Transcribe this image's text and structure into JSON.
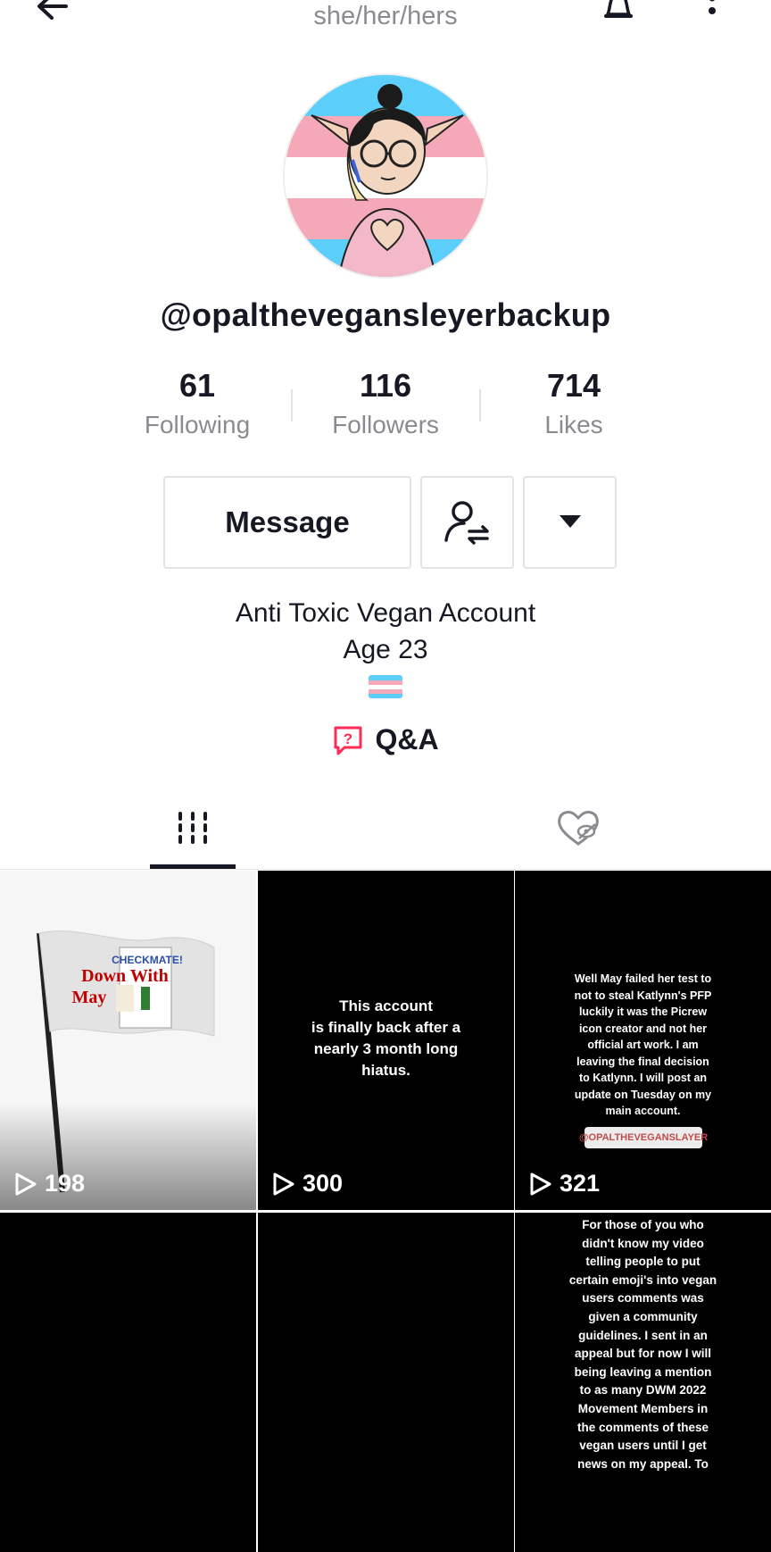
{
  "header": {
    "pronouns": "she/her/hers"
  },
  "profile": {
    "handle": "@opalthevegansleyerbackup",
    "stats": [
      {
        "value": "61",
        "label": "Following"
      },
      {
        "value": "116",
        "label": "Followers"
      },
      {
        "value": "714",
        "label": "Likes"
      }
    ],
    "message_label": "Message",
    "bio_line1": "Anti Toxic Vegan Account",
    "bio_line2": "Age 23",
    "qa_label": "Q&A"
  },
  "colors": {
    "trans_blue": "#5bcefa",
    "trans_pink": "#f5a9b8",
    "accent_red": "#fe2c55",
    "text": "#161823",
    "muted": "#8a8b91"
  },
  "videos": [
    {
      "views": "198",
      "flag_words": [
        "CHECKMATE!",
        "Down With",
        "May"
      ]
    },
    {
      "views": "300",
      "caption": "This account\nis finally back after a\nnearly 3 month long\nhiatus."
    },
    {
      "views": "321",
      "caption": "Well May failed her test to\nnot to steal Katlynn's PFP\nluckily it was the Picrew\nicon creator and not her\nofficial art work. I am\nleaving the final decision\nto Katlynn. I will post an\nupdate on Tuesday on my\nmain account.",
      "tag": "@OPALTHEVEGANSLAYER"
    },
    {
      "views": "",
      "caption": ""
    },
    {
      "views": "",
      "caption": ""
    },
    {
      "views": "",
      "caption": "For those of you who\ndidn't know my video\ntelling people to put\ncertain emoji's into vegan\nusers comments was\ngiven a community\nguidelines. I sent in an\nappeal but for now I will\nbeing leaving a mention\nto as many DWM 2022\nMovement Members in\nthe comments of these\nvegan users until I get\nnews on my appeal. To"
    }
  ]
}
